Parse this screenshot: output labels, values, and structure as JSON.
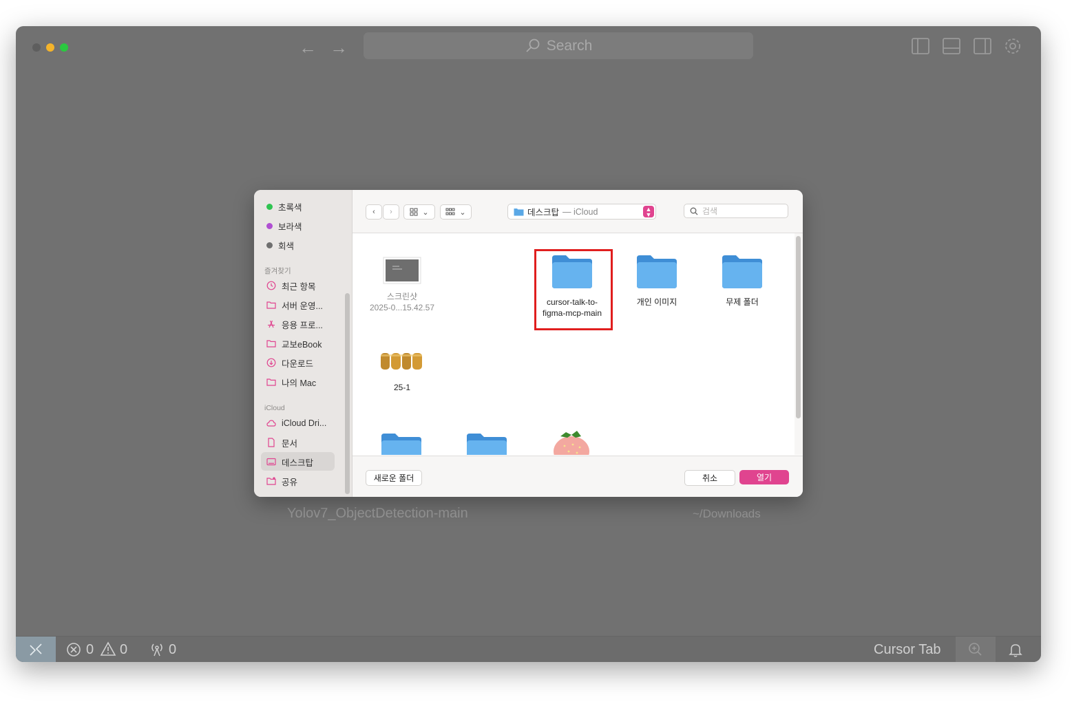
{
  "window": {
    "search_placeholder": "Search",
    "traffic_colors": [
      "#5e5e5e",
      "#f5b42b",
      "#2bc840"
    ],
    "behind_texts": [
      "Yolov7_ObjectDetection-main",
      "~/Downloads"
    ]
  },
  "status_bar": {
    "errors": "0",
    "warnings": "0",
    "ports": "0",
    "right_label": "Cursor Tab"
  },
  "dialog": {
    "sidebar": {
      "tags": [
        {
          "label": "초록색",
          "color": "#2fc451"
        },
        {
          "label": "보라색",
          "color": "#b04fd2"
        },
        {
          "label": "회색",
          "color": "#6f6f6f"
        }
      ],
      "favorites_header": "즐겨찾기",
      "favorites": [
        {
          "label": "최근 항목",
          "icon": "clock-icon"
        },
        {
          "label": "서버 운영...",
          "icon": "folder-icon"
        },
        {
          "label": "응용 프로...",
          "icon": "apps-icon"
        },
        {
          "label": "교보eBook",
          "icon": "folder-icon"
        },
        {
          "label": "다운로드",
          "icon": "download-icon"
        },
        {
          "label": "나의 Mac",
          "icon": "folder-icon"
        }
      ],
      "icloud_header": "iCloud",
      "icloud": [
        {
          "label": "iCloud Dri...",
          "icon": "cloud-icon"
        },
        {
          "label": "문서",
          "icon": "document-icon"
        },
        {
          "label": "데스크탑",
          "icon": "desktop-icon"
        },
        {
          "label": "공유",
          "icon": "shared-folder-icon"
        }
      ]
    },
    "location": {
      "name": "데스크탑",
      "sub": "— iCloud"
    },
    "search_placeholder": "검색",
    "files": [
      {
        "name_line1": "스크린샷",
        "name_line2": "2025-0...15.42.57",
        "kind": "screenshot"
      },
      {
        "name_line1": "cursor-talk-to-",
        "name_line2": "figma-mcp-main",
        "kind": "folder"
      },
      {
        "name_line1": "개인 이미지",
        "name_line2": "",
        "kind": "folder"
      },
      {
        "name_line1": "무제 폴더",
        "name_line2": "",
        "kind": "folder"
      },
      {
        "name_line1": "25-1",
        "name_line2": "",
        "kind": "image-2025"
      }
    ],
    "new_folder_label": "새로운 폴더",
    "cancel_label": "취소",
    "open_label": "열기",
    "accent_color": "#e0448f"
  }
}
